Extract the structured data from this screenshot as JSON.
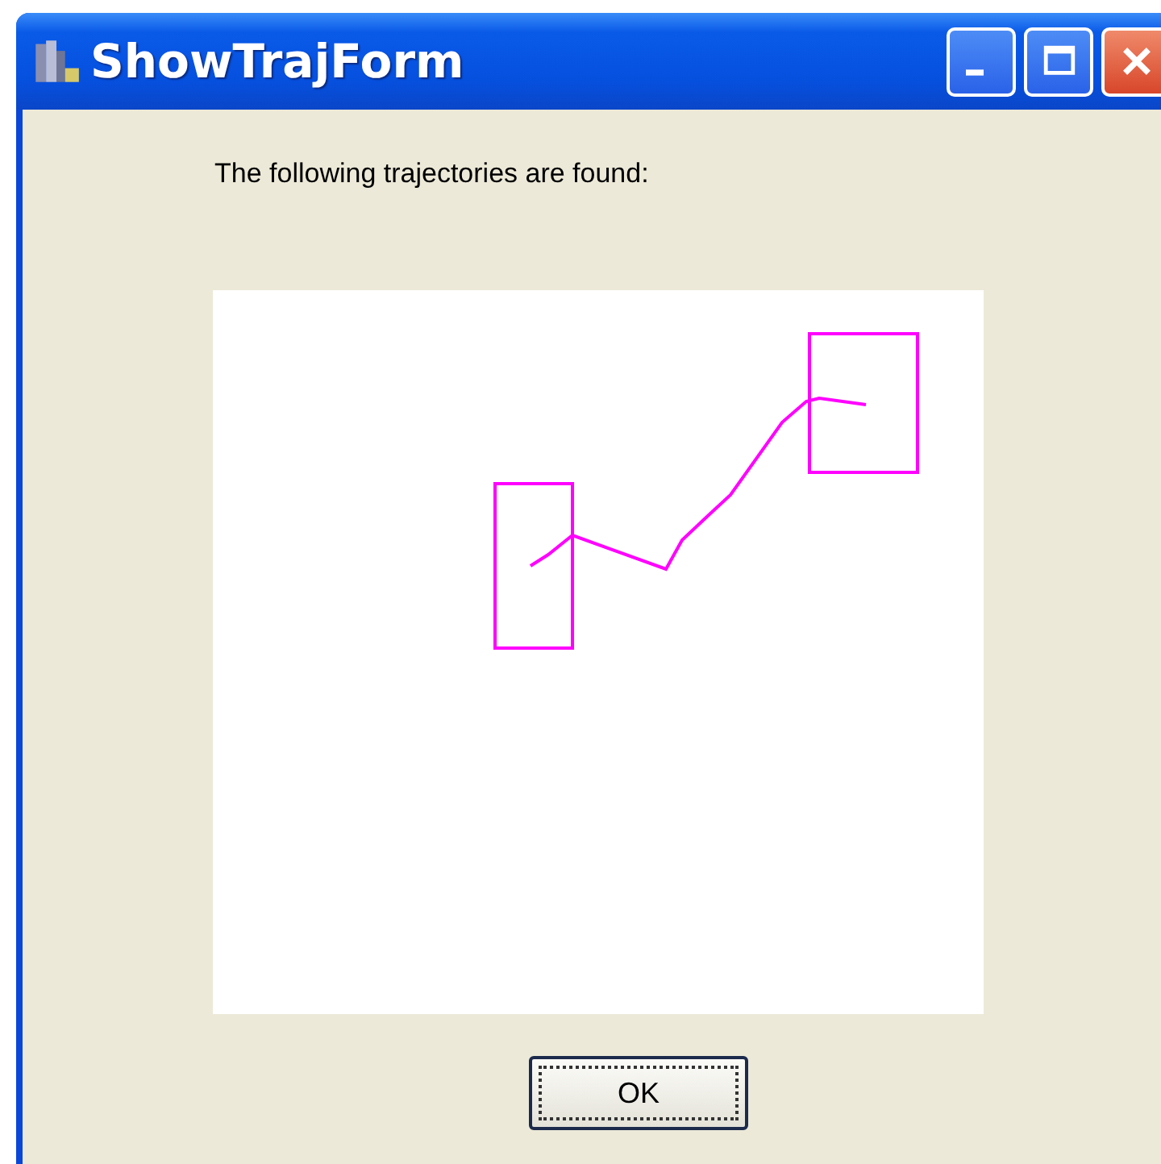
{
  "window": {
    "title": "ShowTrajForm"
  },
  "message": "The following trajectories are found:",
  "ok_button": {
    "label": "OK",
    "focused": true
  }
}
